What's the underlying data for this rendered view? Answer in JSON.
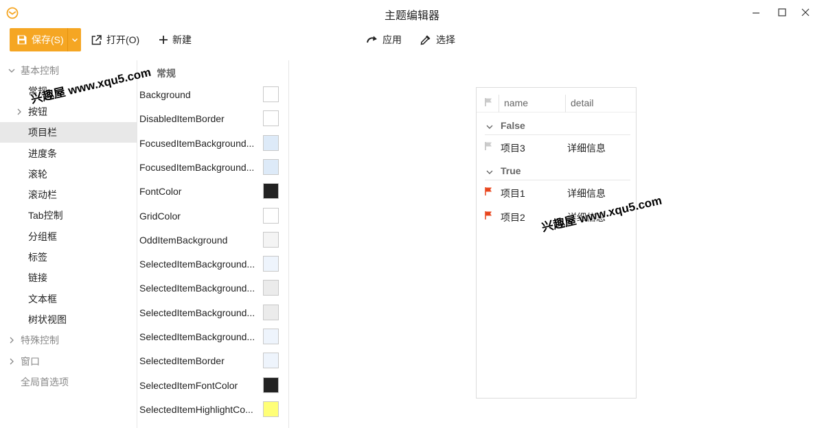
{
  "window": {
    "title": "主题编辑器"
  },
  "toolbar": {
    "save_label": "保存(S)",
    "open_label": "打开(O)",
    "new_label": "新建",
    "apply_label": "应用",
    "pick_label": "选择"
  },
  "nav": {
    "groups": [
      {
        "label": "基本控制",
        "expanded": true
      },
      {
        "label": "特殊控制",
        "expanded": false
      },
      {
        "label": "窗口",
        "expanded": false
      },
      {
        "label": "全局首选项",
        "expanded": false
      }
    ],
    "children": [
      "常规",
      "按钮",
      "项目栏",
      "进度条",
      "滚轮",
      "滚动栏",
      "Tab控制",
      "分组框",
      "标签",
      "链接",
      "文本框",
      "树状视图"
    ],
    "selected": "项目栏"
  },
  "props": {
    "section": "常规",
    "rows": [
      {
        "name": "Background",
        "color": "#ffffff"
      },
      {
        "name": "DisabledItemBorder",
        "color": "#ffffff"
      },
      {
        "name": "FocusedItemBackground...",
        "color": "#ddeaf8"
      },
      {
        "name": "FocusedItemBackground...",
        "color": "#ddeaf8"
      },
      {
        "name": "FontColor",
        "color": "#222222"
      },
      {
        "name": "GridColor",
        "color": "#ffffff"
      },
      {
        "name": "OddItemBackground",
        "color": "#f4f4f4"
      },
      {
        "name": "SelectedItemBackground...",
        "color": "#eef4fc"
      },
      {
        "name": "SelectedItemBackground...",
        "color": "#ebebeb"
      },
      {
        "name": "SelectedItemBackground...",
        "color": "#ebebeb"
      },
      {
        "name": "SelectedItemBackground...",
        "color": "#eef4fc"
      },
      {
        "name": "SelectedItemBorder",
        "color": "#eef4fc"
      },
      {
        "name": "SelectedItemFontColor",
        "color": "#222222"
      },
      {
        "name": "SelectedItemHighlightCo...",
        "color": "#ffff77"
      }
    ]
  },
  "preview": {
    "columns": {
      "name": "name",
      "detail": "detail"
    },
    "groups": [
      {
        "label": "False",
        "items": [
          {
            "name": "项目3",
            "detail": "详细信息",
            "flagged": false
          }
        ]
      },
      {
        "label": "True",
        "items": [
          {
            "name": "项目1",
            "detail": "详细信息",
            "flagged": true
          },
          {
            "name": "项目2",
            "detail": "详细信息",
            "flagged": true
          }
        ]
      }
    ]
  },
  "watermark": {
    "text": "兴趣屋 www.xqu5.com"
  },
  "colors": {
    "accent": "#f5a623",
    "flag": "#e8461e",
    "selected_nav": "#e8e8e8"
  }
}
